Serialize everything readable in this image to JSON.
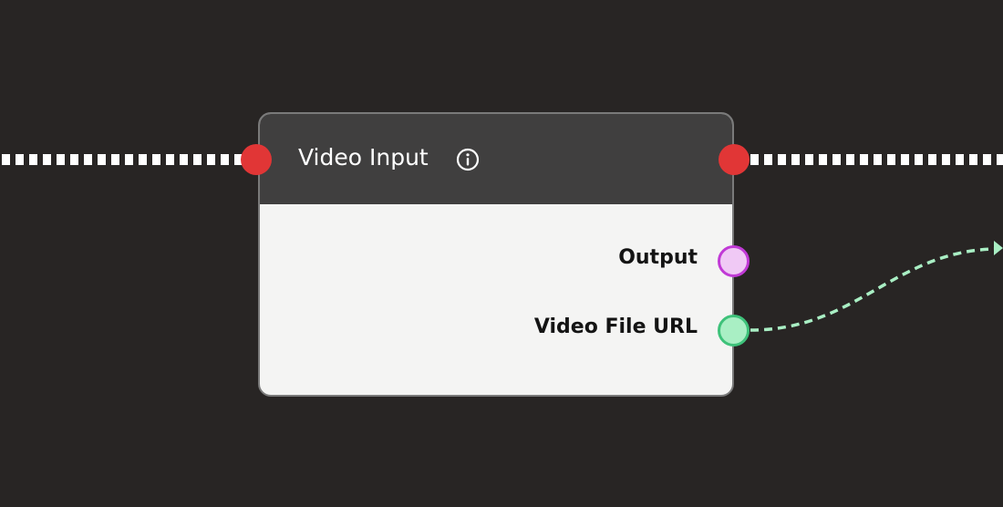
{
  "node": {
    "title": "Video Input",
    "info_icon": "info-circle-icon",
    "outputs": [
      {
        "label": "Output",
        "color": "#c13ad6",
        "fill": "#f0c9f5"
      },
      {
        "label": "Video File URL",
        "color": "#3ec27a",
        "fill": "#a9efc4"
      }
    ]
  },
  "colors": {
    "background": "#282524",
    "header": "#403f3f",
    "body": "#f4f4f3",
    "exec_port": "#e13636",
    "exec_wire": "#ffffff",
    "data_wire": "#a9efc4"
  }
}
